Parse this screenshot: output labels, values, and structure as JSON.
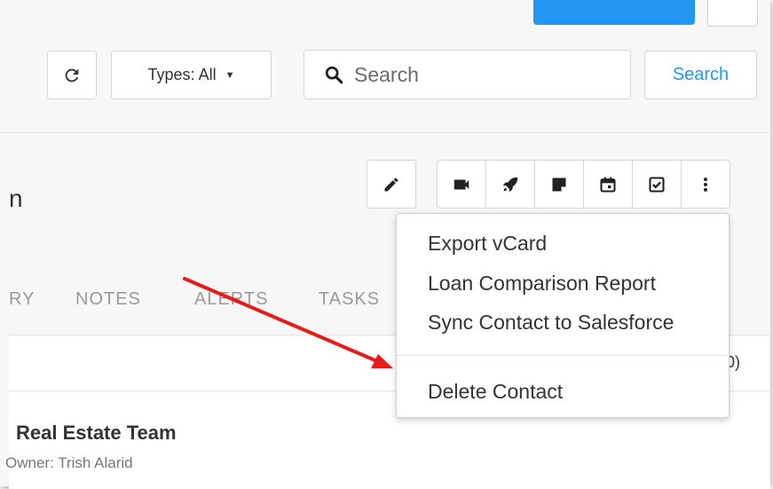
{
  "toolbar": {
    "types_label": "Types: All",
    "search_placeholder": "Search",
    "search_button": "Search"
  },
  "contact": {
    "name_fragment": "n"
  },
  "tabs": [
    "RY",
    "NOTES",
    "ALERTS",
    "TASKS"
  ],
  "list": {
    "count_fragment": "0)",
    "team_name": "Real Estate Team",
    "owner": "Owner: Trish Alarid"
  },
  "menu": {
    "items": [
      "Export vCard",
      "Loan Comparison Report",
      "Sync Contact to Salesforce"
    ],
    "delete": "Delete Contact"
  },
  "icons": {
    "refresh": "refresh-icon",
    "caret": "caret-down-icon",
    "search": "search-icon",
    "edit": "pencil-icon",
    "actions": [
      "video-icon",
      "rocket-icon",
      "note-icon",
      "calendar-icon",
      "checkbox-icon",
      "more-vertical-icon"
    ]
  },
  "colors": {
    "accent": "#2196f3",
    "annotation_arrow": "#e81b1b"
  }
}
